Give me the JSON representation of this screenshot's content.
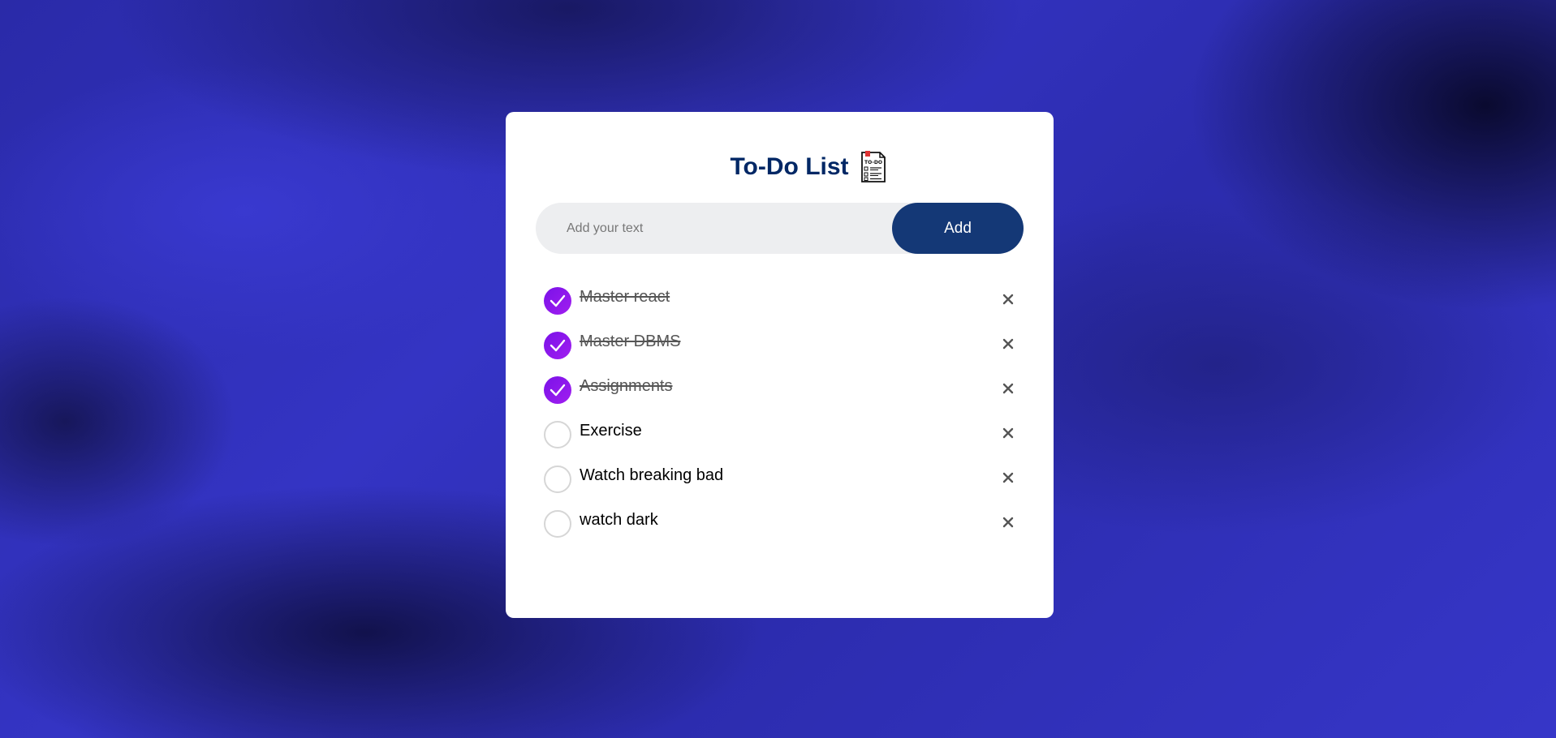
{
  "app": {
    "title": "To-Do List",
    "title_icon": "todo-note-icon"
  },
  "input": {
    "placeholder": "Add your text",
    "value": "",
    "add_label": "Add"
  },
  "tasks": [
    {
      "label": "Master react",
      "checked": true
    },
    {
      "label": "Master DBMS",
      "checked": true
    },
    {
      "label": "Assignments",
      "checked": true
    },
    {
      "label": "Exercise",
      "checked": false
    },
    {
      "label": "Watch breaking bad",
      "checked": false
    },
    {
      "label": "watch dark",
      "checked": false
    }
  ],
  "icons": {
    "check": "checkmark-icon",
    "delete": "close-icon"
  },
  "colors": {
    "title": "#002765",
    "add_button": "#143876",
    "check_fill": "#8a16ec",
    "input_background": "#edeef0"
  }
}
